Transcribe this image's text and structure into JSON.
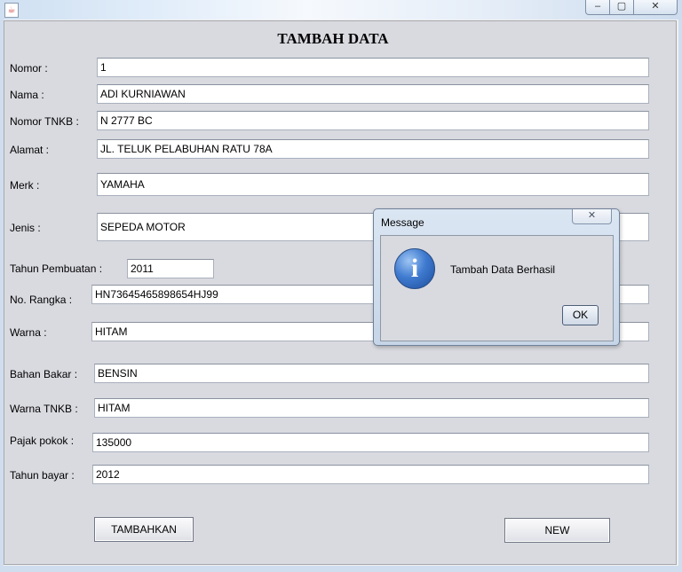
{
  "window": {
    "min_glyph": "–",
    "max_glyph": "▢",
    "close_glyph": "✕"
  },
  "form": {
    "title": "TAMBAH DATA",
    "fields": {
      "nomor": {
        "label": "Nomor   :",
        "value": "1"
      },
      "nama": {
        "label": "Nama    :",
        "value": "ADI KURNIAWAN"
      },
      "nomor_tnkb": {
        "label": "Nomor TNKB :",
        "value": "N 2777 BC"
      },
      "alamat": {
        "label": "Alamat :",
        "value": "JL. TELUK PELABUHAN RATU 78A"
      },
      "merk": {
        "label": "Merk    :",
        "value": "YAMAHA"
      },
      "jenis": {
        "label": "Jenis    :",
        "value": "SEPEDA MOTOR"
      },
      "tahun_pembuatan": {
        "label": "Tahun Pembuatan  :",
        "value": "2011"
      },
      "no_rangka": {
        "label": "No. Rangka  :",
        "value": "HN73645465898654HJ99"
      },
      "warna": {
        "label": "Warna :",
        "value": "HITAM"
      },
      "bahan_bakar": {
        "label": "Bahan Bakar :",
        "value": "BENSIN"
      },
      "warna_tnkb": {
        "label": "Warna TNKB :",
        "value": "HITAM"
      },
      "pajak_pokok": {
        "label": "Pajak pokok  :",
        "value": "135000"
      },
      "tahun_bayar": {
        "label": "Tahun bayar :",
        "value": "2012"
      }
    },
    "buttons": {
      "tambahkan": "TAMBAHKAN",
      "new": "NEW"
    }
  },
  "dialog": {
    "title": "Message",
    "message": "Tambah Data Berhasil",
    "ok_label": "OK",
    "icon": "information-icon"
  }
}
